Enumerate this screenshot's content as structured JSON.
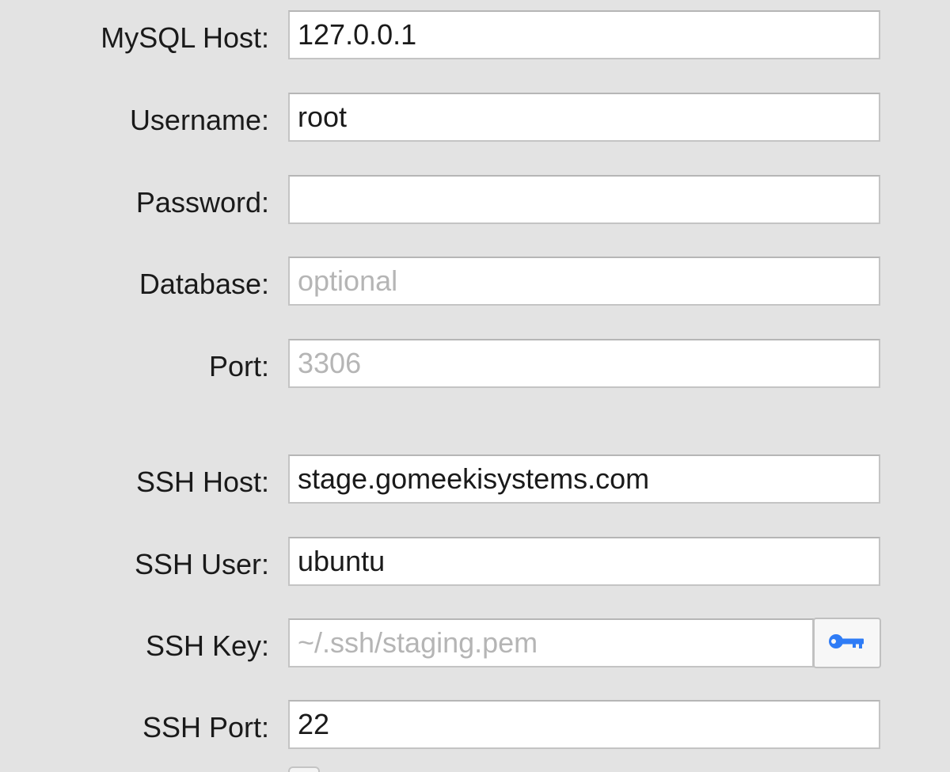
{
  "form": {
    "mysql_host": {
      "label": "MySQL Host:",
      "value": "127.0.0.1",
      "placeholder": ""
    },
    "username": {
      "label": "Username:",
      "value": "root",
      "placeholder": ""
    },
    "password": {
      "label": "Password:",
      "value": "",
      "placeholder": ""
    },
    "database": {
      "label": "Database:",
      "value": "",
      "placeholder": "optional"
    },
    "port": {
      "label": "Port:",
      "value": "",
      "placeholder": "3306"
    },
    "ssh_host": {
      "label": "SSH Host:",
      "value": "stage.gomeekisystems.com",
      "placeholder": ""
    },
    "ssh_user": {
      "label": "SSH User:",
      "value": "ubuntu",
      "placeholder": ""
    },
    "ssh_key": {
      "label": "SSH Key:",
      "value": "",
      "placeholder": "~/.ssh/staging.pem",
      "button_icon": "key-icon"
    },
    "ssh_port": {
      "label": "SSH Port:",
      "value": "22",
      "placeholder": ""
    }
  },
  "colors": {
    "background": "#e3e3e3",
    "field_border": "#c4c4c4",
    "placeholder": "#b5b5b5",
    "key_icon": "#2f7cf6"
  }
}
